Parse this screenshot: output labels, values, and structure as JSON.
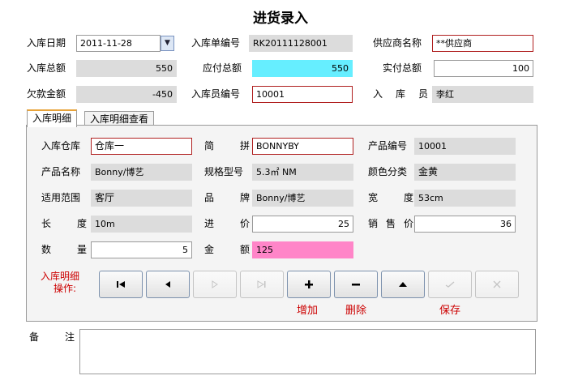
{
  "title": "进货录入",
  "header": {
    "date_label": "入库日期",
    "date_value": "2011-11-28",
    "dropdown_glyph": "▼",
    "order_no_label": "入库单编号",
    "order_no_value": "RK20111128001",
    "supplier_label": "供应商名称",
    "supplier_value": "**供应商",
    "total_label": "入库总额",
    "total_value": "550",
    "payable_label": "应付总额",
    "payable_value": "550",
    "paid_label": "实付总额",
    "paid_value": "100",
    "owed_label": "欠款金额",
    "owed_value": "-450",
    "operator_no_label": "入库员编号",
    "operator_no_value": "10001",
    "operator_label": "入 库 员",
    "operator_value": "李红"
  },
  "tabs": [
    {
      "label": "入库明细",
      "active": true
    },
    {
      "label": "入库明细查看",
      "active": false
    }
  ],
  "detail": {
    "warehouse_label": "入库仓库",
    "warehouse_value": "仓库一",
    "short_label": "简 拼",
    "short_value": "BONNYBY",
    "product_no_label": "产品编号",
    "product_no_value": "10001",
    "product_name_label": "产品名称",
    "product_name_value": "Bonny/博艺",
    "spec_label": "规格型号",
    "spec_value": "5.3㎡ NM",
    "color_label": "颜色分类",
    "color_value": "金黄",
    "scope_label": "适用范围",
    "scope_value": "客厅",
    "brand_label": "品 牌",
    "brand_value": "Bonny/博艺",
    "width_label": "宽 度",
    "width_value": "53cm",
    "length_label": "长 度",
    "length_value": "10m",
    "in_price_label": "进 价",
    "in_price_value": "25",
    "sale_price_label": "销 售 价",
    "sale_price_value": "36",
    "qty_label": "数 量",
    "qty_value": "5",
    "amount_label": "金 额",
    "amount_value": "125"
  },
  "ops": {
    "label_line1": "入库明细",
    "label_line2": "操作:",
    "first_icon": "first-record-icon",
    "prev_icon": "prev-record-icon",
    "next_icon": "next-record-icon",
    "last_icon": "last-record-icon",
    "add_icon": "plus-icon",
    "delete_icon": "minus-icon",
    "up_icon": "up-arrow-icon",
    "save_icon": "check-icon",
    "cancel_icon": "cross-icon",
    "add_label": "增加",
    "delete_label": "删除",
    "save_label": "保存"
  },
  "remark": {
    "label": "备 注",
    "value": ""
  },
  "colors": {
    "payable_bg": "#66eeff",
    "amount_bg": "#ff85c8",
    "ops_label": "#cc0000",
    "tab_accent": "#e8a33a"
  }
}
